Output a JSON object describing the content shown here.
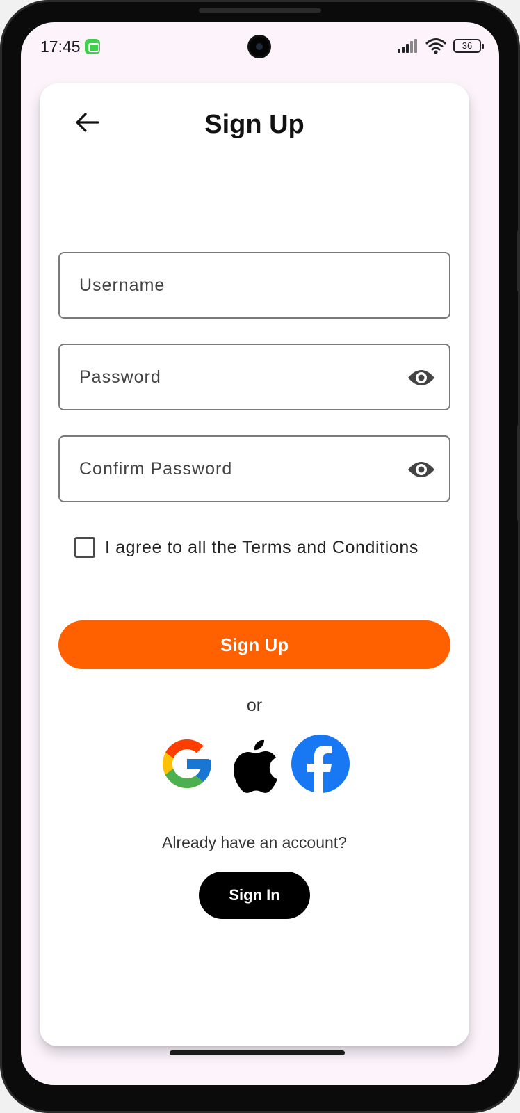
{
  "status_bar": {
    "time": "17:45",
    "battery": "36"
  },
  "header": {
    "title": "Sign Up"
  },
  "form": {
    "username_placeholder": "Username",
    "password_placeholder": "Password",
    "confirm_placeholder": "Confirm Password",
    "username_value": "",
    "password_value": "",
    "confirm_value": "",
    "terms_label": "I agree to all the Terms and Conditions",
    "terms_checked": false,
    "signup_label": "Sign Up"
  },
  "social": {
    "or_text": "or",
    "providers": [
      "google-icon",
      "apple-icon",
      "facebook-icon"
    ]
  },
  "footer": {
    "already_text": "Already have an account?",
    "signin_label": "Sign In"
  },
  "colors": {
    "accent": "#ff6100",
    "screen_bg": "#fcf3fb",
    "signin_bg": "#000000"
  }
}
